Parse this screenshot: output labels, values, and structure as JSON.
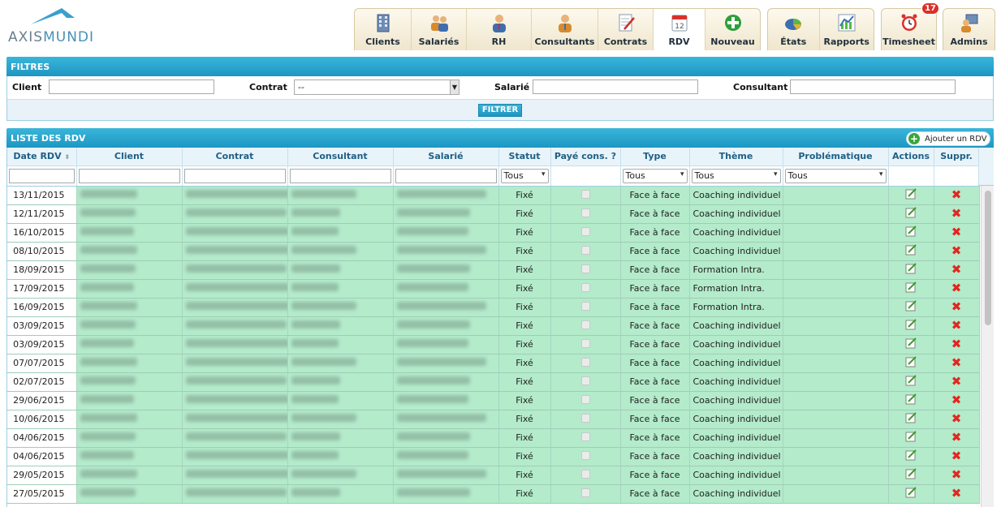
{
  "brand": {
    "logo_part1": "AXIS",
    "logo_part2": "MUNDI"
  },
  "nav": {
    "group1": [
      {
        "label": "Clients",
        "icon": "building-icon"
      },
      {
        "label": "Salariés",
        "icon": "people-icon"
      },
      {
        "label": "RH",
        "icon": "person-icon"
      },
      {
        "label": "Consultants",
        "icon": "consultant-icon"
      },
      {
        "label": "Contrats",
        "icon": "contract-icon"
      },
      {
        "label": "RDV",
        "icon": "calendar-icon",
        "active": true
      },
      {
        "label": "Nouveau",
        "icon": "add-icon"
      }
    ],
    "group2": [
      {
        "label": "États",
        "icon": "pie-chart-icon"
      },
      {
        "label": "Rapports",
        "icon": "report-chart-icon"
      }
    ],
    "group3": [
      {
        "label": "Timesheet",
        "icon": "alarm-clock-icon",
        "badge": "17"
      }
    ],
    "group4": [
      {
        "label": "Admins",
        "icon": "admin-icon"
      }
    ]
  },
  "filters": {
    "title": "FILTRES",
    "client_label": "Client",
    "contrat_label": "Contrat",
    "contrat_value": "--",
    "salarie_label": "Salarié",
    "consultant_label": "Consultant",
    "button": "FILTRER"
  },
  "list": {
    "title": "LISTE DES RDV",
    "add_button": "Ajouter un RDV",
    "columns": [
      "Date RDV",
      "Client",
      "Contrat",
      "Consultant",
      "Salarié",
      "Statut",
      "Payé cons. ?",
      "Type",
      "Thème",
      "Problématique",
      "Actions",
      "Suppr."
    ],
    "select_all": "Tous",
    "rows": [
      {
        "date": "13/11/2015",
        "statut": "Fixé",
        "type": "Face à face",
        "theme": "Coaching individuel"
      },
      {
        "date": "12/11/2015",
        "statut": "Fixé",
        "type": "Face à face",
        "theme": "Coaching individuel"
      },
      {
        "date": "16/10/2015",
        "statut": "Fixé",
        "type": "Face à face",
        "theme": "Coaching individuel"
      },
      {
        "date": "08/10/2015",
        "statut": "Fixé",
        "type": "Face à face",
        "theme": "Coaching individuel"
      },
      {
        "date": "18/09/2015",
        "statut": "Fixé",
        "type": "Face à face",
        "theme": "Formation Intra."
      },
      {
        "date": "17/09/2015",
        "statut": "Fixé",
        "type": "Face à face",
        "theme": "Formation Intra."
      },
      {
        "date": "16/09/2015",
        "statut": "Fixé",
        "type": "Face à face",
        "theme": "Formation Intra."
      },
      {
        "date": "03/09/2015",
        "statut": "Fixé",
        "type": "Face à face",
        "theme": "Coaching individuel"
      },
      {
        "date": "03/09/2015",
        "statut": "Fixé",
        "type": "Face à face",
        "theme": "Coaching individuel"
      },
      {
        "date": "07/07/2015",
        "statut": "Fixé",
        "type": "Face à face",
        "theme": "Coaching individuel"
      },
      {
        "date": "02/07/2015",
        "statut": "Fixé",
        "type": "Face à face",
        "theme": "Coaching individuel"
      },
      {
        "date": "29/06/2015",
        "statut": "Fixé",
        "type": "Face à face",
        "theme": "Coaching individuel"
      },
      {
        "date": "10/06/2015",
        "statut": "Fixé",
        "type": "Face à face",
        "theme": "Coaching individuel"
      },
      {
        "date": "04/06/2015",
        "statut": "Fixé",
        "type": "Face à face",
        "theme": "Coaching individuel"
      },
      {
        "date": "04/06/2015",
        "statut": "Fixé",
        "type": "Face à face",
        "theme": "Coaching individuel"
      },
      {
        "date": "29/05/2015",
        "statut": "Fixé",
        "type": "Face à face",
        "theme": "Coaching individuel"
      },
      {
        "date": "27/05/2015",
        "statut": "Fixé",
        "type": "Face à face",
        "theme": "Coaching individuel"
      }
    ]
  },
  "colors": {
    "accent": "#1c97c3",
    "row_bg": "#b3ebcb",
    "delete": "#e0271f",
    "badge": "#d9312a"
  }
}
